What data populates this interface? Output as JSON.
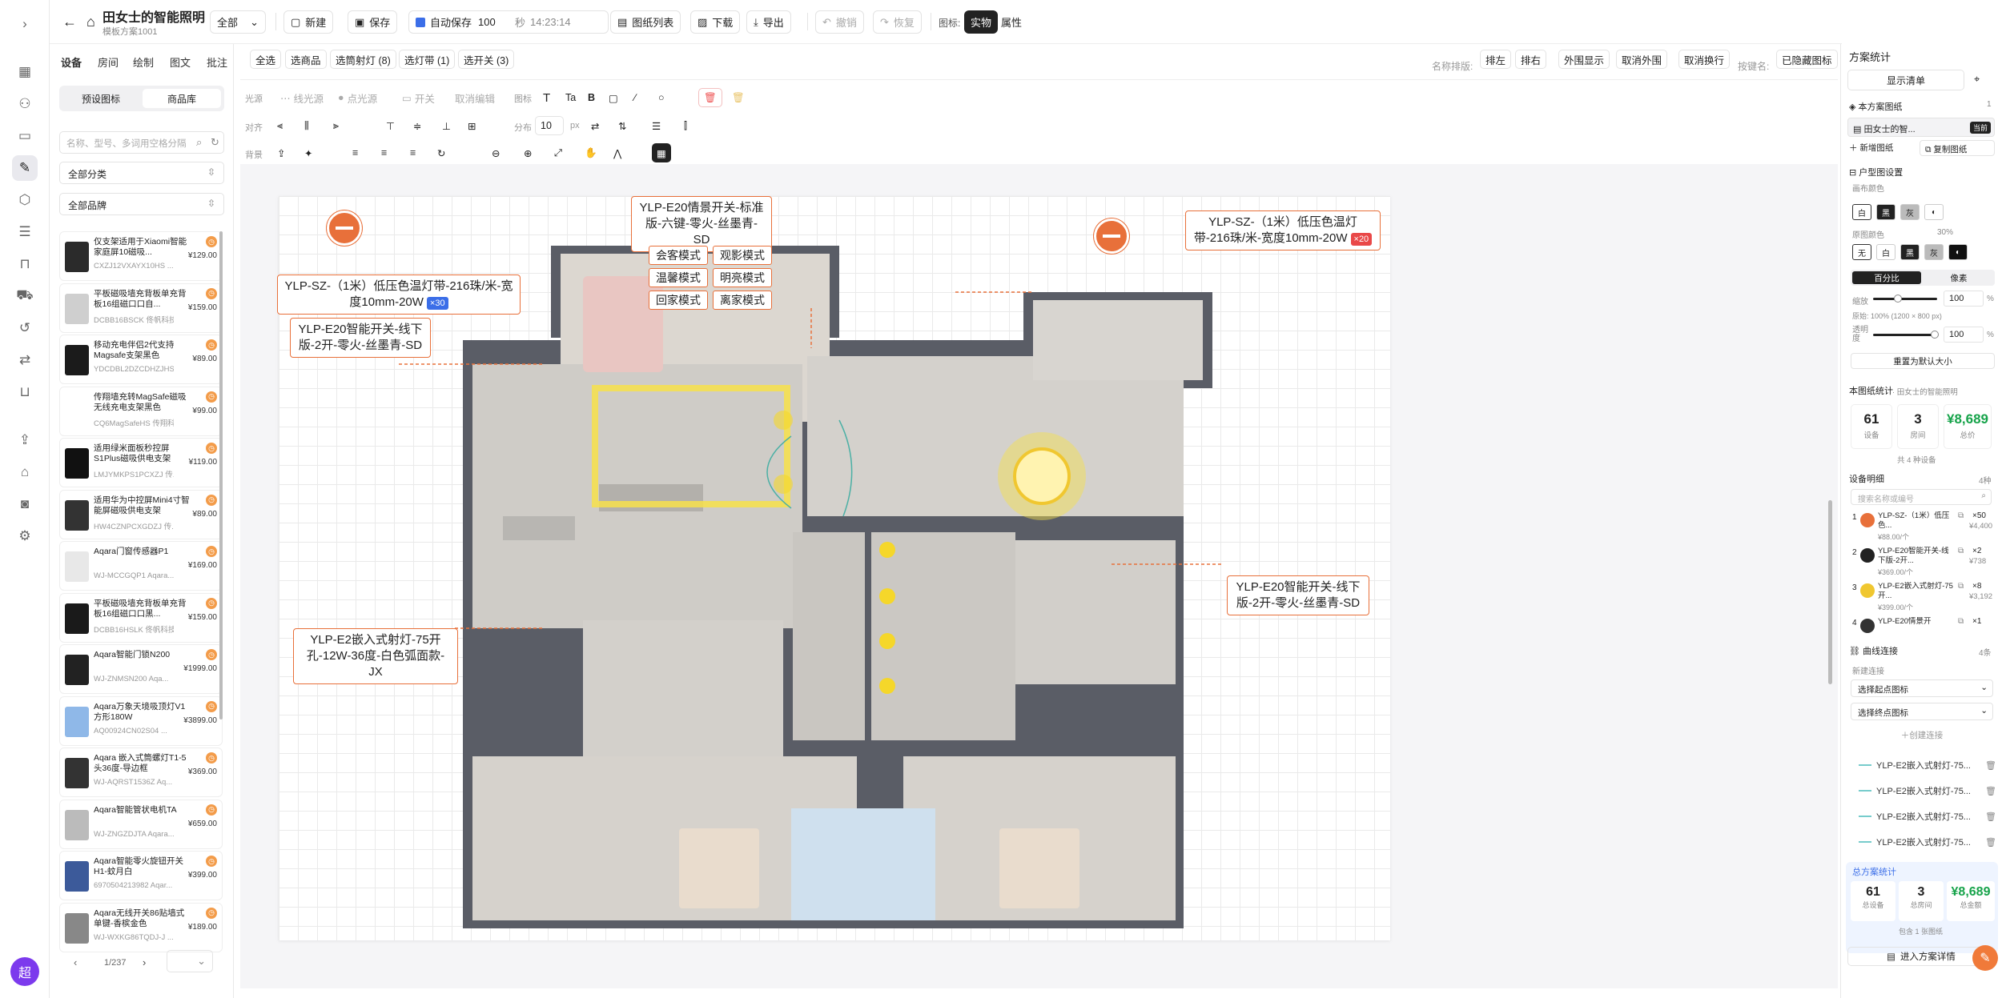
{
  "rail": {
    "items": [
      "dashboard-icon",
      "users-icon",
      "folder-icon",
      "design-icon",
      "cube-icon",
      "list-icon",
      "bag-icon",
      "truck-icon",
      "history-icon",
      "swap-icon",
      "cart-icon",
      "upload-icon",
      "store-icon",
      "robot-icon",
      "settings-icon"
    ],
    "avatar": "超"
  },
  "header": {
    "title": "田女士的智能照明",
    "subtitle": "模板方案1001",
    "scope": "全部",
    "new": "新建",
    "save": "保存",
    "autosave": "自动保存",
    "autosave_val": "100",
    "sec": "秒",
    "time": "14:23:14",
    "drawing_list": "图纸列表",
    "download": "下载",
    "export": "导出",
    "undo": "撤销",
    "redo": "恢复",
    "icon_label": "图标:",
    "mode_real": "实物",
    "mode_attr": "属性"
  },
  "left": {
    "tabs": [
      "设备",
      "房间",
      "绘制",
      "图文",
      "批注"
    ],
    "sub_tabs": [
      "预设图标",
      "商品库"
    ],
    "search_placeholder": "名称、型号、多词用空格分隔",
    "category": "全部分类",
    "brand": "全部品牌",
    "pager": "1/237",
    "items": [
      {
        "name": "仅支架适用于Xiaomi智能家庭屏10磁吸...",
        "code": "CXZJ12VXAYX10HS ...",
        "price": "¥129.00"
      },
      {
        "name": "平板磁吸墙充背板单充背板16组磁口口自...",
        "code": "DCBB16BSCK 佟帆科技",
        "price": "¥159.00"
      },
      {
        "name": "移动充电伴侣2代支持Magsafe支架黑色",
        "code": "YDCDBL2DZCDHZJHS ...",
        "price": "¥89.00"
      },
      {
        "name": "传翔墙充转MagSafe磁吸无线充电支架黑色",
        "code": "CQ6MagSafeHS 传翔科...",
        "price": "¥99.00"
      },
      {
        "name": "适用绿米面板秒控屏S1Plus磁吸供电支架",
        "code": "LMJYMKPS1PCXZJ 传...",
        "price": "¥119.00"
      },
      {
        "name": "适用华为中控屏Mini4寸智能屏磁吸供电支架",
        "code": "HW4CZNPCXGDZJ 传...",
        "price": "¥89.00"
      },
      {
        "name": "Aqara门窗传感器P1",
        "code": "WJ-MCCGQP1 Aqara...",
        "price": "¥169.00"
      },
      {
        "name": "平板磁吸墙充背板单充背板16组磁口口黑...",
        "code": "DCBB16HSLK 佟帆科技",
        "price": "¥159.00"
      },
      {
        "name": "Aqara智能门锁N200",
        "code": "WJ-ZNMSN200 Aqa...",
        "price": "¥1999.00"
      },
      {
        "name": "Aqara万象天境吸顶灯V1方形180W",
        "code": "AQ00924CN02S04 ...",
        "price": "¥3899.00"
      },
      {
        "name": "Aqara 嵌入式筒螺灯T1-5头36度-导边框",
        "code": "WJ-AQRST1536Z Aq...",
        "price": "¥369.00"
      },
      {
        "name": "Aqara智能管状电机TA",
        "code": "WJ-ZNGZDJTA Aqara...",
        "price": "¥659.00"
      },
      {
        "name": "Aqara智能零火旋钮开关H1-蚊月白",
        "code": "6970504213982 Aqar...",
        "price": "¥399.00"
      },
      {
        "name": "Aqara无线开关86贴墙式单键-香槟金色",
        "code": "WJ-WXKG86TQDJ-J ...",
        "price": "¥189.00"
      }
    ]
  },
  "tools": {
    "row1": [
      "全选",
      "选商品",
      "选筒射灯 (8)",
      "选灯带 (1)",
      "选开关 (3)"
    ],
    "sort_label": "名称排版:",
    "sort_btns": [
      "排左",
      "排右"
    ],
    "row1_right": [
      "外围显示",
      "取消外围",
      "取消换行"
    ],
    "key_label": "按键名:",
    "key_btn": "已隐藏图标",
    "row2_label": "光源",
    "row2": [
      "线光源",
      "点光源",
      "开关",
      "取消编辑"
    ],
    "icon2": "图标",
    "row3_label": "对齐",
    "dist_label": "分布",
    "dist_val": "10",
    "px": "px",
    "row4_label": "背景"
  },
  "canvas": {
    "callouts": [
      {
        "text": "YLP-E20情景开关-标准版-六键-零火-丝墨青-SD"
      },
      {
        "text": "YLP-SZ-（1米）低压色温灯带-216珠/米-宽度10mm-20W",
        "qty": "×30"
      },
      {
        "text": "YLP-SZ-（1米）低压色温灯带-216珠/米-宽度10mm-20W",
        "qty": "×20"
      },
      {
        "text": "YLP-E20智能开关-线下版-2开-零火-丝墨青-SD"
      },
      {
        "text": "YLP-E20智能开关-线下版-2开-零火-丝墨青-SD"
      },
      {
        "text": "YLP-E2嵌入式射灯-75开孔-12W-36度-白色弧面款-JX"
      }
    ],
    "modes": [
      "会客模式",
      "观影模式",
      "温馨模式",
      "明亮模式",
      "回家模式",
      "离家模式"
    ]
  },
  "right": {
    "title": "方案统计",
    "show_list": "显示清单",
    "this_drawing": "本方案图纸",
    "count": "1",
    "drawing_name": "田女士的智...",
    "tag": "当前",
    "new_drawing": "新增图纸",
    "copy_drawing": "复制图纸",
    "layout_settings": "户型图设置",
    "bg_color": "画布颜色",
    "border_color": "原图颜色",
    "pct": "30%",
    "pct_btn": "百分比",
    "px_btn": "像素",
    "zoom_label": "缩放",
    "zoom_val": "100",
    "zoom_unit": "%",
    "orig": "原始: 100% (1200 × 800 px)",
    "opacity_label": "透明度",
    "opacity_val": "100",
    "reset": "重置为默认大小",
    "stats_title": "本图纸统计",
    "stats_owner": "· 田女士的智能照明",
    "devices": "61",
    "devices_l": "设备",
    "rooms": "3",
    "rooms_l": "房间",
    "total": "¥8,689",
    "total_l": "总价",
    "kinds": "共 4 种设备",
    "dev_title": "设备明细",
    "dev_count": "4种",
    "dev_search": "搜索名称或编号",
    "devs": [
      {
        "no": "1",
        "name": "YLP-SZ-（1米）低压色...",
        "price": "¥88.00/个",
        "qty": "×50",
        "sum": "¥4,400"
      },
      {
        "no": "2",
        "name": "YLP-E20智能开关-线下版-2开...",
        "price": "¥369.00/个",
        "qty": "×2",
        "sum": "¥738"
      },
      {
        "no": "3",
        "name": "YLP-E2嵌入式射灯-75开...",
        "price": "¥399.00/个",
        "qty": "×8",
        "sum": "¥3,192"
      },
      {
        "no": "4",
        "name": "YLP-E20情景开",
        "qty": "×1"
      }
    ],
    "curve_title": "曲线连接",
    "curve_count": "4条",
    "new_conn": "新建连接",
    "pick_start": "选择起点图标",
    "pick_end": "选择终点图标",
    "create_conn": "创建连接",
    "conns": [
      "YLP-E2嵌入式射灯-75...",
      "YLP-E2嵌入式射灯-75...",
      "YLP-E2嵌入式射灯-75...",
      "YLP-E2嵌入式射灯-75..."
    ],
    "total_title": "总方案统计",
    "t_devices": "61",
    "t_devices_l": "总设备",
    "t_rooms": "3",
    "t_rooms_l": "总房间",
    "t_total": "¥8,689",
    "t_total_l": "总金额",
    "t_note": "包含 1 张图纸",
    "enter": "进入方案详情"
  },
  "colors": {
    "accent": "#e8703a",
    "green": "#16a34a",
    "blue": "#3b6ee8"
  }
}
